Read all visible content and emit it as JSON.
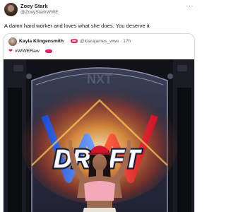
{
  "author": {
    "display_name": "Zoey Stark",
    "handle": "@ZoeyStarkWWE"
  },
  "tweet": {
    "text": "A damn hard worker and loves what she does. You deserve it",
    "more_icon": "···"
  },
  "quote": {
    "display_name": "Kayla Klingensmith",
    "handle_time": "@kiarajames_wwe · 17h",
    "heart_icon": "❤",
    "hashtag": "#WWERaw"
  },
  "media": {
    "sign_word": "DRAFT",
    "sign_top": "NXT"
  },
  "colors": {
    "text_primary": "#0f1419",
    "text_secondary": "#536471",
    "border": "#cfd9de",
    "heart": "#e0245e"
  }
}
